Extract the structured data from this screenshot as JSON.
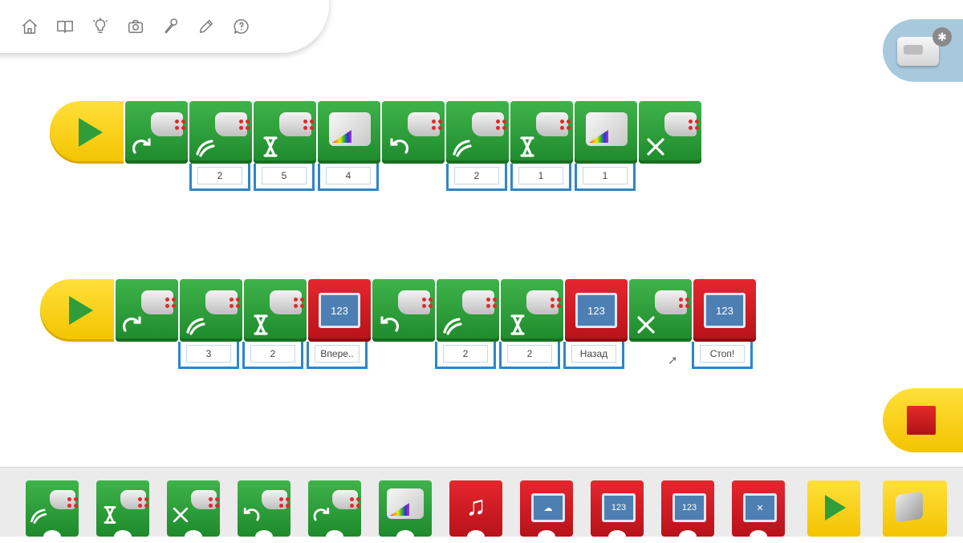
{
  "toolbar": {
    "icons": [
      "home-icon",
      "book-icon",
      "lightbulb-icon",
      "camera-icon",
      "microphone-icon",
      "pencil-icon",
      "help-icon"
    ]
  },
  "hub": {
    "bluetooth_glyph": "✱"
  },
  "program1": {
    "blocks": [
      {
        "type": "motor-clockwise",
        "color": "green"
      },
      {
        "type": "motor-power",
        "color": "green",
        "param": "2"
      },
      {
        "type": "motor-on-for",
        "color": "green",
        "param": "5"
      },
      {
        "type": "light",
        "color": "green",
        "param": "4"
      },
      {
        "type": "motor-counterclockwise",
        "color": "green"
      },
      {
        "type": "motor-power",
        "color": "green",
        "param": "2"
      },
      {
        "type": "motor-on-for",
        "color": "green",
        "param": "1"
      },
      {
        "type": "light",
        "color": "green",
        "param": "1"
      },
      {
        "type": "motor-off",
        "color": "green"
      }
    ]
  },
  "program2": {
    "blocks": [
      {
        "type": "motor-clockwise",
        "color": "green"
      },
      {
        "type": "motor-power",
        "color": "green",
        "param": "3"
      },
      {
        "type": "motor-on-for",
        "color": "green",
        "param": "2"
      },
      {
        "type": "display-text",
        "color": "red",
        "param": "Впере..",
        "screen": "123"
      },
      {
        "type": "motor-counterclockwise",
        "color": "green"
      },
      {
        "type": "motor-power",
        "color": "green",
        "param": "2"
      },
      {
        "type": "motor-on-for",
        "color": "green",
        "param": "2"
      },
      {
        "type": "display-text",
        "color": "red",
        "param": "Назад",
        "screen": "123"
      },
      {
        "type": "motor-off",
        "color": "green"
      },
      {
        "type": "display-text",
        "color": "red",
        "param": "Стоп!",
        "screen": "123"
      }
    ]
  },
  "palette": {
    "screen_label": "123",
    "items": [
      "motor-power",
      "motor-on-for",
      "motor-off",
      "motor-counterclockwise",
      "motor-clockwise",
      "light",
      "play-sound",
      "display-background",
      "display-text",
      "display-add",
      "display-clear",
      "start",
      "key-press"
    ]
  },
  "colors": {
    "green": "#1e8a2c",
    "red": "#b8121a",
    "yellow": "#f3c300",
    "param_border": "#2e86c8"
  }
}
